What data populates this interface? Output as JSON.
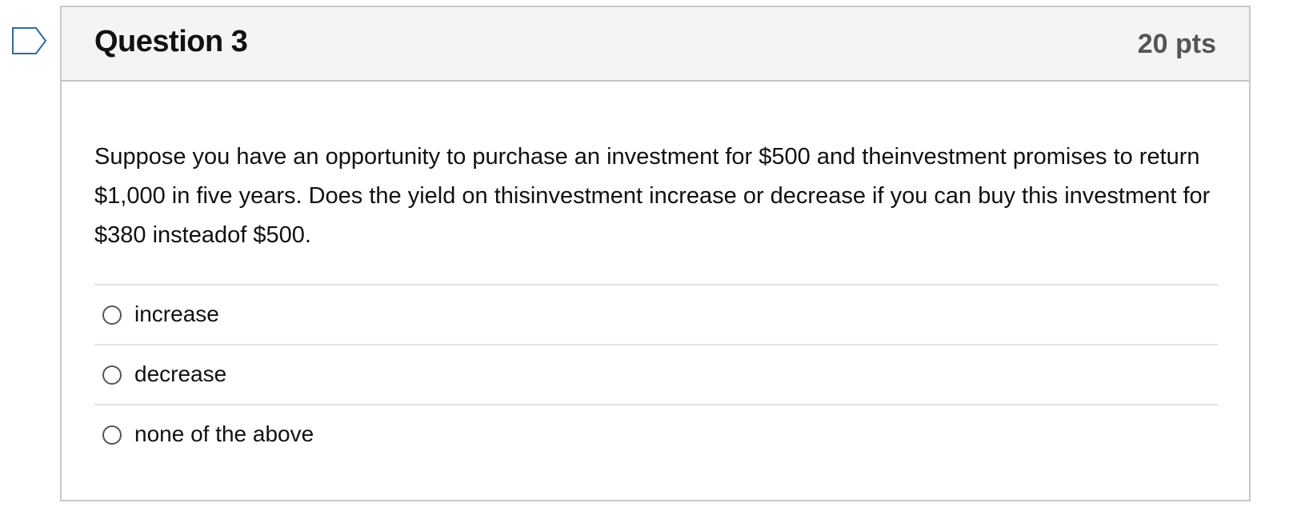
{
  "flag": {
    "icon": "bookmark-flag-icon",
    "color": "#2d6da3"
  },
  "question": {
    "title": "Question 3",
    "points": "20 pts",
    "text": "Suppose you have an opportunity to purchase an investment for $500 and theinvestment promises to return $1,000 in five years. Does the yield on thisinvestment increase or decrease if you can buy this investment for $380 insteadof $500.",
    "answers": [
      {
        "label": "increase",
        "selected": false
      },
      {
        "label": "decrease",
        "selected": false
      },
      {
        "label": "none of the above",
        "selected": false
      }
    ]
  }
}
